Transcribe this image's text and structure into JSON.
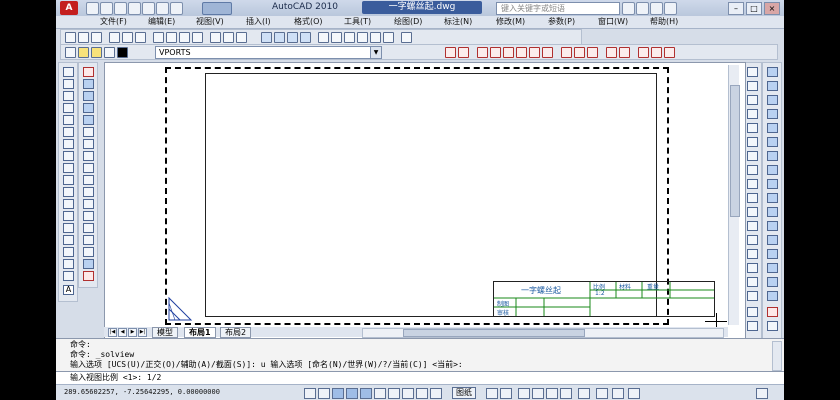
{
  "app": {
    "name": "AutoCAD 2010",
    "document": "一字螺丝起.dwg",
    "search_placeholder": "键入关键字或短语"
  },
  "menu": [
    "文件(F)",
    "编辑(E)",
    "视图(V)",
    "插入(I)",
    "格式(O)",
    "工具(T)",
    "绘图(D)",
    "标注(N)",
    "修改(M)",
    "参数(P)",
    "窗口(W)",
    "帮助(H)"
  ],
  "layer": {
    "current": "VPORTS"
  },
  "title_block": {
    "name": "一字螺丝起",
    "scale_label": "比例",
    "material_label": "材料",
    "weight_label": "重量",
    "scale_value": "1:2",
    "drawn_label": "制图",
    "audit_label": "审核"
  },
  "tabs": {
    "model": "模型",
    "layout1": "布局1",
    "layout2": "布局2"
  },
  "command": {
    "line1": "命令:",
    "line2": "命令:  _solview",
    "line3": "输入选项 [UCS(U)/正交(O)/辅助(A)/截面(S)]: u 输入选项 [命名(N)/世界(W)/?/当前(C)] <当前>:",
    "prompt": "输入视图比例 <1>: 1/2"
  },
  "status": {
    "coords": "289.65602257, -7.25642295, 0.00000000",
    "paper_label": "图纸"
  }
}
